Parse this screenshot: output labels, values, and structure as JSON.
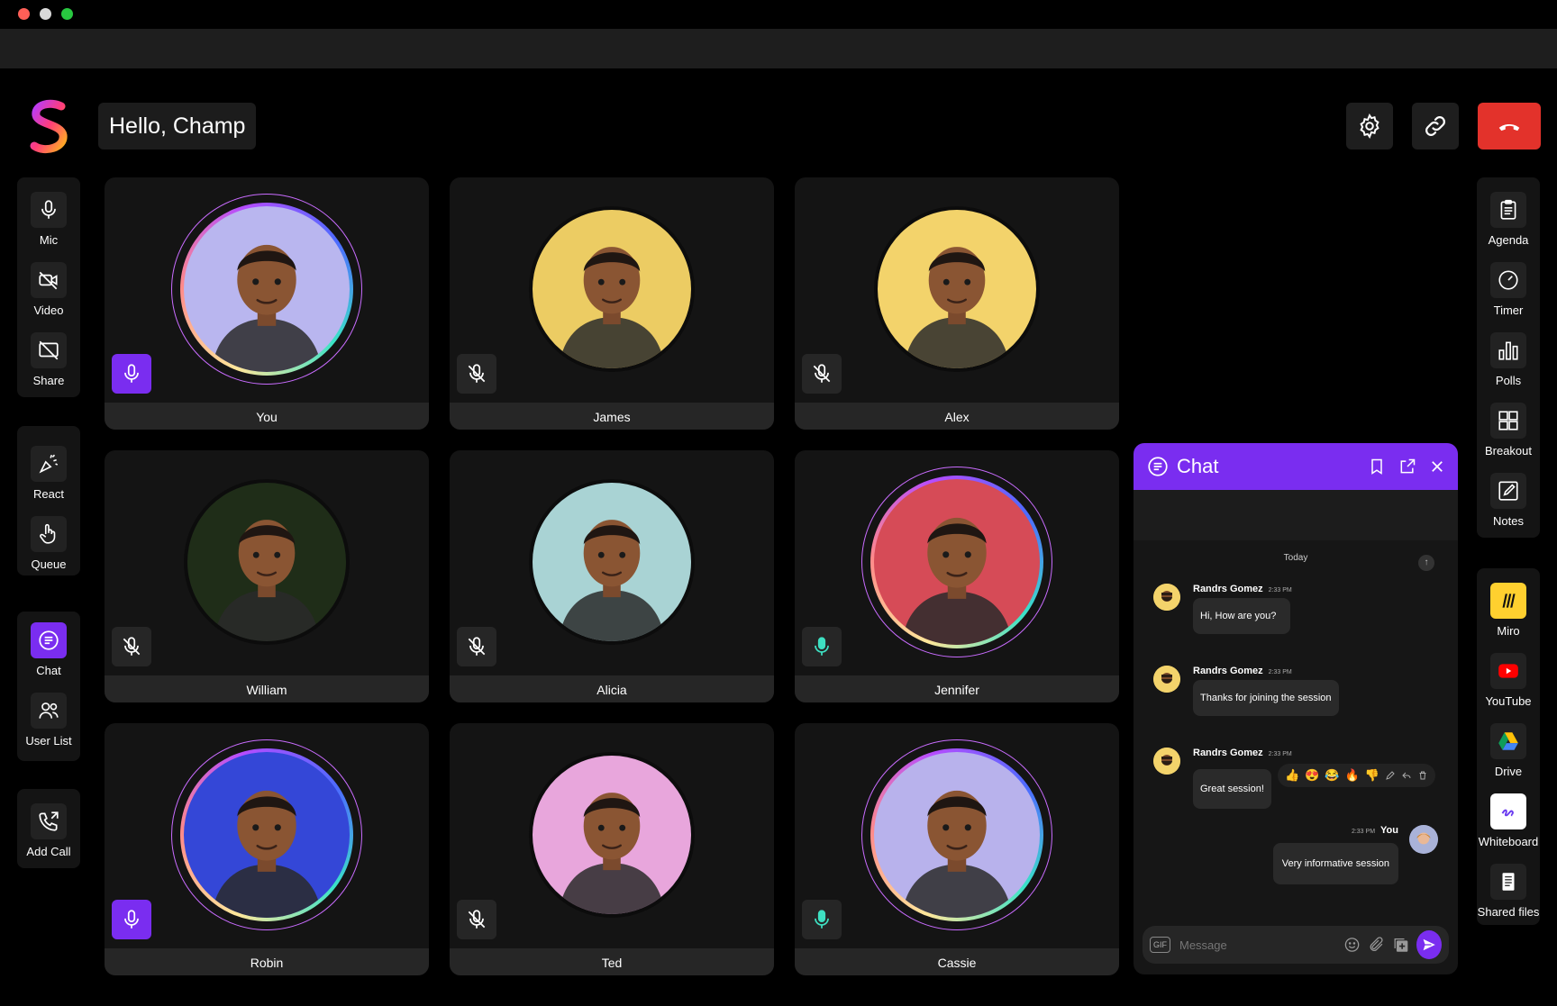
{
  "header": {
    "greeting": "Hello, Champ"
  },
  "left_toolbar": {
    "groups": [
      [
        {
          "label": "Mic",
          "icon": "mic-icon"
        },
        {
          "label": "Video",
          "icon": "video-off-icon"
        },
        {
          "label": "Share",
          "icon": "share-screen-off-icon"
        }
      ],
      [
        {
          "label": "React",
          "icon": "react-icon"
        },
        {
          "label": "Queue",
          "icon": "hand-icon"
        }
      ],
      [
        {
          "label": "Chat",
          "icon": "chat-icon",
          "active": true
        },
        {
          "label": "User List",
          "icon": "users-icon"
        }
      ],
      [
        {
          "label": "Add Call",
          "icon": "add-call-icon"
        }
      ]
    ]
  },
  "participants": [
    {
      "name": "You",
      "mic": "on",
      "bg": "#b9b6ef",
      "ring": true
    },
    {
      "name": "James",
      "mic": "muted",
      "bg": "#eccc63",
      "ring": false
    },
    {
      "name": "Alex",
      "mic": "muted",
      "bg": "#f3d36b",
      "ring": false
    },
    {
      "name": "William",
      "mic": "muted",
      "bg": "#1f2d18",
      "ring": false
    },
    {
      "name": "Alicia",
      "mic": "muted",
      "bg": "#a9d3d4",
      "ring": false
    },
    {
      "name": "Jennifer",
      "mic": "speaking",
      "bg": "#d64b57",
      "ring": true
    },
    {
      "name": "Robin",
      "mic": "on",
      "bg": "#3447d7",
      "ring": true
    },
    {
      "name": "Ted",
      "mic": "muted",
      "bg": "#e8a6dc",
      "ring": false
    },
    {
      "name": "Cassie",
      "mic": "speaking",
      "bg": "#b8b2ec",
      "ring": true
    }
  ],
  "right_toolbar": {
    "group1": [
      {
        "label": "Agenda",
        "icon": "clipboard-icon"
      },
      {
        "label": "Timer",
        "icon": "timer-icon"
      },
      {
        "label": "Polls",
        "icon": "poll-icon"
      },
      {
        "label": "Breakout",
        "icon": "breakout-icon"
      },
      {
        "label": "Notes",
        "icon": "notes-icon"
      }
    ],
    "group2": [
      {
        "label": "Miro",
        "icon": "miro-icon"
      },
      {
        "label": "YouTube",
        "icon": "youtube-icon"
      },
      {
        "label": "Drive",
        "icon": "drive-icon"
      },
      {
        "label": "Whiteboard",
        "icon": "whiteboard-icon"
      },
      {
        "label": "Shared files",
        "icon": "file-icon"
      }
    ]
  },
  "chat": {
    "title": "Chat",
    "date_separator": "Today",
    "messages": [
      {
        "sender": "Randrs Gomez",
        "time": "2:33 PM",
        "text": "Hi, How are you?"
      },
      {
        "sender": "Randrs Gomez",
        "time": "2:33 PM",
        "text": "Thanks for joining the session"
      },
      {
        "sender": "Randrs Gomez",
        "time": "2:33 PM",
        "text": "Great session!"
      },
      {
        "sender": "You",
        "time": "2:33 PM",
        "text": "Very informative session"
      }
    ],
    "reactions": [
      "👍",
      "😍",
      "😂",
      "🔥",
      "👎"
    ],
    "input": {
      "placeholder": "Message",
      "gif_label": "GIF"
    }
  },
  "colors": {
    "accent": "#7a2df0",
    "end_call": "#e3322b",
    "speaking": "#3ee0c2"
  }
}
